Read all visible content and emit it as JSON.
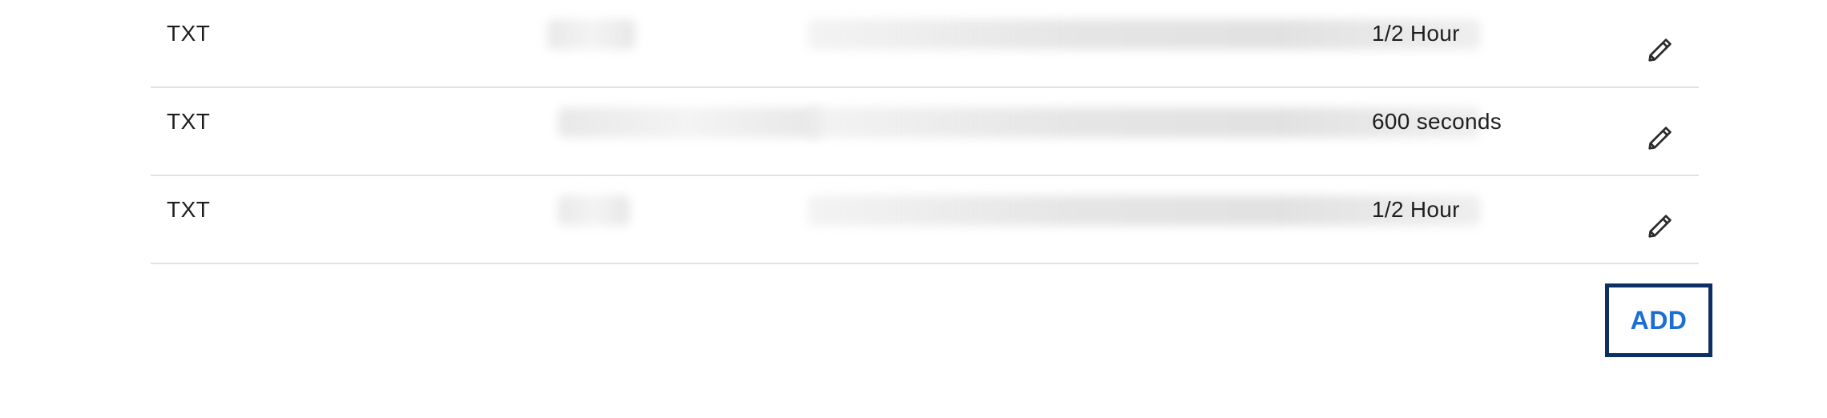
{
  "records": [
    {
      "type": "TXT",
      "ttl": "1/2 Hour",
      "edit_icon": "pencil-icon"
    },
    {
      "type": "TXT",
      "ttl": "600 seconds",
      "edit_icon": "pencil-icon"
    },
    {
      "type": "TXT",
      "ttl": "1/2 Hour",
      "edit_icon": "pencil-icon"
    }
  ],
  "actions": {
    "add_label": "ADD"
  },
  "colors": {
    "add_text": "#1b6fd1",
    "add_border": "#0d2f63",
    "divider": "#e2e2e2"
  }
}
